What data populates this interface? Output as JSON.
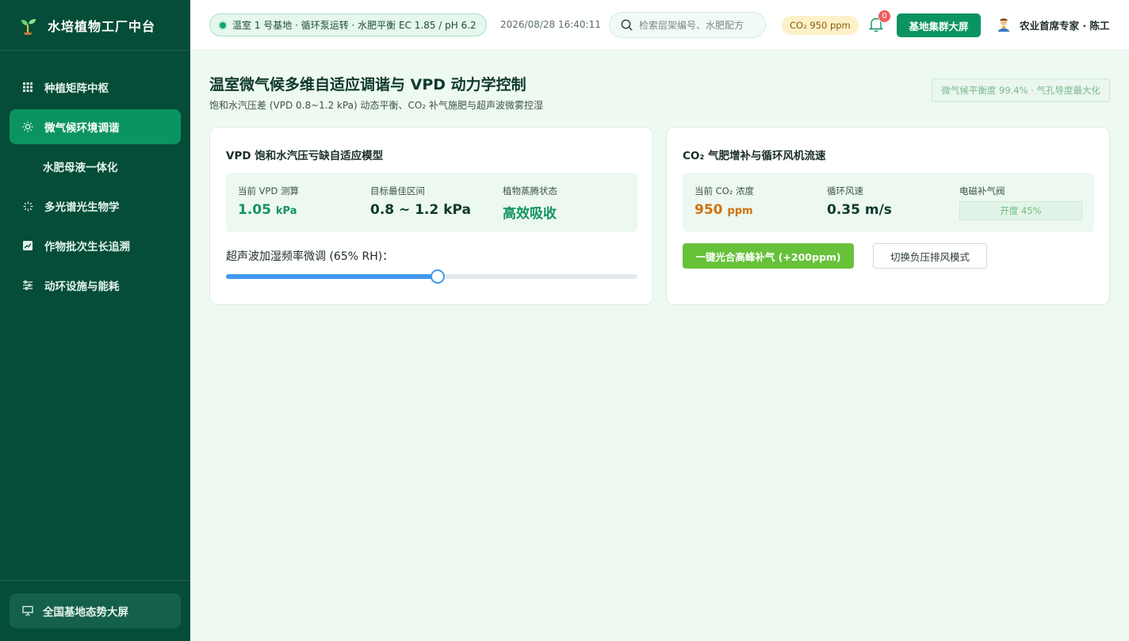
{
  "sidebar": {
    "brand": "水培植物工厂中台",
    "items": [
      {
        "label": "种植矩阵中枢",
        "icon": "grid-icon"
      },
      {
        "label": "微气候环境调谐",
        "icon": "sun-icon",
        "active": true
      },
      {
        "label": "水肥母液一体化",
        "icon": ""
      },
      {
        "label": "多光谱光生物学",
        "icon": "spark-icon"
      },
      {
        "label": "作物批次生长追溯",
        "icon": "chart-icon"
      },
      {
        "label": "动环设施与能耗",
        "icon": "sliders-icon"
      }
    ],
    "footer_label": "全国基地态势大屏"
  },
  "header": {
    "status": "温室 1 号基地 · 循环泵运转 · 水肥平衡 EC 1.85 / pH 6.2",
    "datetime": "2026/08/28 16:40:11",
    "search_placeholder": "检索层架编号、水肥配方",
    "co2_badge": "CO₂ 950 ppm",
    "notification_count": "0",
    "big_screen_button": "基地集群大屏",
    "user_name": "农业首席专家 · 陈工"
  },
  "page": {
    "title": "温室微气候多维自适应调谐与 VPD 动力学控制",
    "subtitle": "饱和水汽压差 (VPD 0.8~1.2 kPa) 动态平衡、CO₂ 补气施肥与超声波微雾控湿",
    "balance_tag": "微气候平衡度 99.4% · 气孔导度最大化"
  },
  "vpd_card": {
    "title": "VPD 饱和水汽压亏缺自适应模型",
    "metric1_label": "当前 VPD 测算",
    "metric1_value": "1.05",
    "metric1_unit": "kPa",
    "metric2_label": "目标最佳区间",
    "metric2_value": "0.8 ~ 1.2 kPa",
    "metric3_label": "植物蒸腾状态",
    "metric3_value": "高效吸收",
    "slider_label": "超声波加湿频率微调 (65% RH)：",
    "slider_fraction": 0.514
  },
  "co2_card": {
    "title": "CO₂ 气肥增补与循环风机流速",
    "metric1_label": "当前 CO₂ 浓度",
    "metric1_value": "950",
    "metric1_unit": "ppm",
    "metric2_label": "循环风速",
    "metric2_value": "0.35 m/s",
    "metric3_label": "电磁补气阀",
    "metric3_value": "开度 45%",
    "primary_button": "一键光合高峰补气 (+200ppm)",
    "secondary_button": "切换负压排风模式"
  },
  "colors": {
    "sidebar_bg": "#054d38",
    "accent": "#0b9461",
    "highlight_green": "#13945f",
    "co2_orange": "#d0720a",
    "action_green": "#67c23a",
    "slider_blue": "#4099f0"
  }
}
